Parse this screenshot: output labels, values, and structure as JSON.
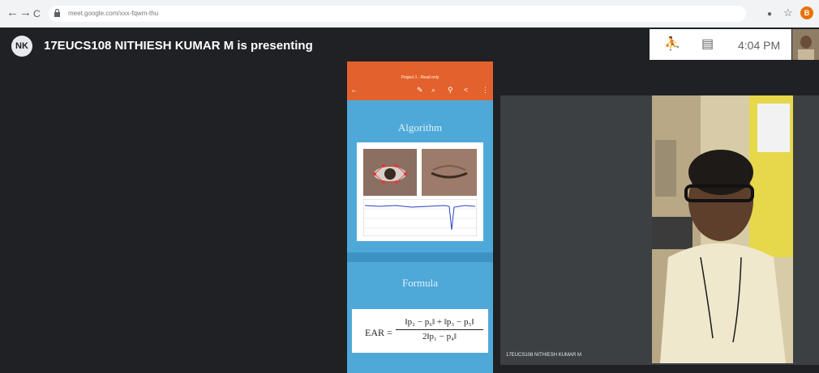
{
  "browser": {
    "nav": {
      "back": "←",
      "forward": "→",
      "reload": "C"
    },
    "url": "meet.google.com/xxx-fqwm-thu",
    "icons": {
      "cast": "●",
      "star": "☆"
    },
    "profile_initial": "B"
  },
  "meet": {
    "presenter_initials": "NK",
    "presenting_text": "17EUCS108 NITHIESH KUMAR M is presenting",
    "controls": {
      "people": "⛹",
      "chat": "▤"
    },
    "clock": "4:04 PM",
    "tile_name": "17EUCS108 NITHIESH KUMAR M"
  },
  "slide": {
    "app_title": "Project 1 - Read only",
    "heading1": "Algorithm",
    "heading2": "Formula",
    "formula": {
      "lhs": "EAR =",
      "numerator": "‖p₂ − p₆‖ + ‖p₃ − p₅‖",
      "denominator": "2‖p₁ − p₄‖"
    },
    "toolbar_icons": [
      "←",
      "✎",
      "⌕",
      "⚲",
      "<",
      "⋮"
    ]
  },
  "colors": {
    "meet_bg": "#202124",
    "slide_bg": "#4fa9d8",
    "app_bar": "#e3612c"
  }
}
